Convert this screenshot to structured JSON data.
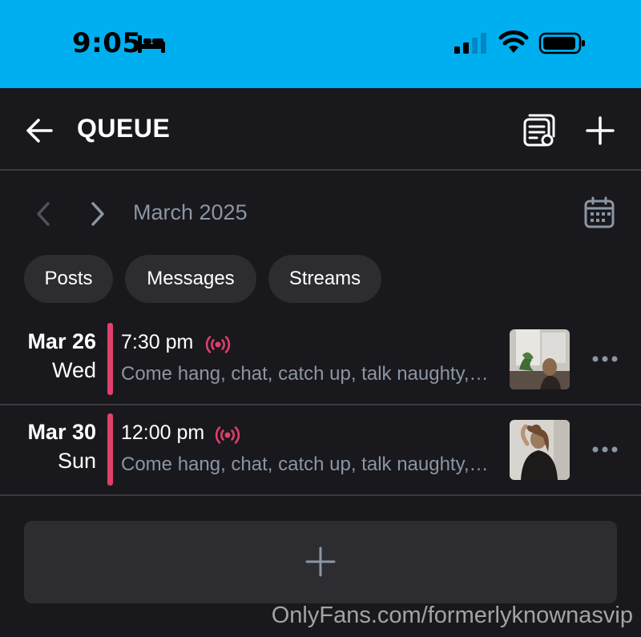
{
  "status_bar": {
    "time": "9:05",
    "bg_color": "#00aff0",
    "icons": [
      "bed-icon",
      "cellular-signal-icon",
      "wifi-icon",
      "battery-icon"
    ]
  },
  "header": {
    "title": "QUEUE",
    "icons": [
      "back-arrow-icon",
      "list-settings-icon",
      "plus-icon"
    ]
  },
  "month_nav": {
    "label": "March 2025",
    "icons": [
      "chevron-left-icon",
      "chevron-right-icon",
      "calendar-icon"
    ]
  },
  "filters": [
    {
      "label": "Posts"
    },
    {
      "label": "Messages"
    },
    {
      "label": "Streams"
    }
  ],
  "queue": [
    {
      "date": "Mar 26",
      "weekday": "Wed",
      "time": "7:30 pm",
      "description": "Come hang, chat, catch up, talk naughty, whatever you want",
      "type_icon": "live-stream-icon",
      "accent_color": "#e0406b"
    },
    {
      "date": "Mar 30",
      "weekday": "Sun",
      "time": "12:00 pm",
      "description": "Come hang, chat, catch up, talk naughty, whatever you want",
      "type_icon": "live-stream-icon",
      "accent_color": "#e0406b"
    }
  ],
  "add_card": {
    "icon": "plus-icon"
  },
  "watermark": "OnlyFans.com/formerlyknownasvip"
}
